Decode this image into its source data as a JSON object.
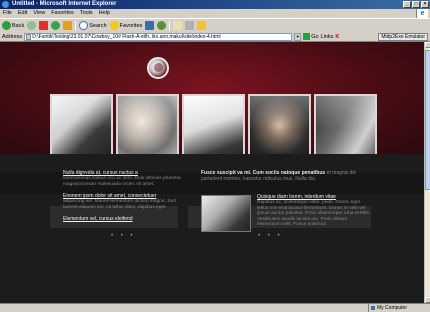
{
  "window": {
    "title": "Untitled - Microsoft Internet Explorer",
    "controls": [
      "_",
      "□",
      "×"
    ]
  },
  "menu": [
    "File",
    "Edit",
    "View",
    "Favorites",
    "Tools",
    "Help"
  ],
  "toolbar": {
    "back": "Back",
    "search": "Search",
    "favorites": "Favorites"
  },
  "address": {
    "label": "Address",
    "url": "D:\\Funtik\\Testing\\23.01.07\\Cowboy_10# Flash-A-eilh..liro.ann.makul\\site\\index-4.html",
    "go": "Go",
    "links": "Links",
    "kaspersky": "K",
    "midp": "Midp2Exe Emulator"
  },
  "news": [
    {
      "title": "Nulla dignvida at, cursus nuctus a",
      "text": "loremanenas finibus orci ac sem. Duis ultricies pharetra magnacrumsan malesuada orciec sit amet."
    },
    {
      "title": "Enonem ipsm dolor sit amet, consectetuer",
      "text": "adipiscing elit. Mauris fermentum dictum magna. Sed laoreet aliquam leo. Ut tellus dolor, dapibus eget."
    },
    {
      "title": "Elementum vel, cursus eleifend",
      "text": ""
    }
  ],
  "intro": {
    "bold": "Fusce suscipit va mi. Cum sociis natoque penatibus",
    "rest": "et magnis dis parturient montes, nascetur ridiculus mus. Nulla dui."
  },
  "feature": {
    "title": "Quisque diam lorem, interdum vitae",
    "text": "Dapibus ac, scelerisque vitae, pede. Donec eget tellus non erat lacinia fermentum. Donec in velit vel ipsum auctor pulvinar. Proin ullamcorper urna et felis. Vestibulum iaculis lacinia est. Proin dictum elementum velit. Fusce euismod"
  },
  "dots": "• • •",
  "status": {
    "zone": "My Computer"
  }
}
